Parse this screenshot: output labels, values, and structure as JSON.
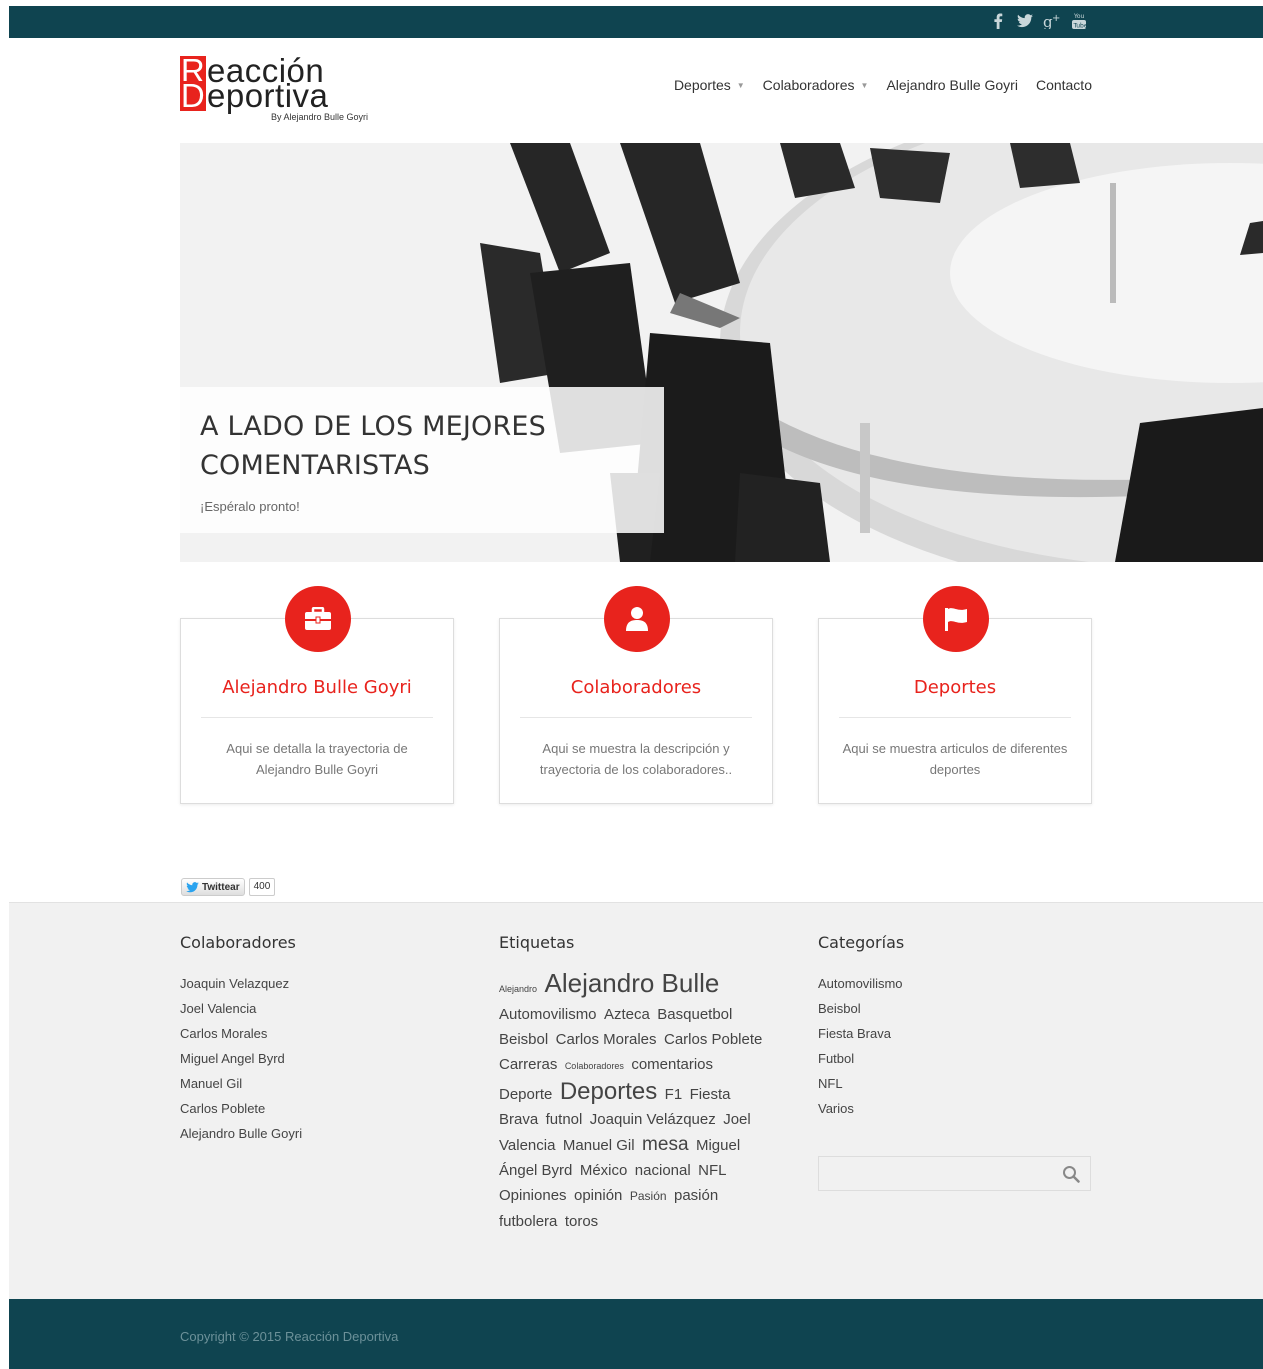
{
  "social": {
    "icons": [
      "facebook-icon",
      "twitter-icon",
      "google-plus-icon",
      "youtube-icon"
    ],
    "labels": [
      "f",
      "",
      "g+",
      ""
    ]
  },
  "header": {
    "logo_line1": "eacción",
    "logo_line1_cap": "R",
    "logo_line2": "eportiva",
    "logo_line2_cap": "D",
    "logo_by": "By Alejandro Bulle Goyri"
  },
  "nav": {
    "items": [
      {
        "label": "Deportes",
        "caret": "▼"
      },
      {
        "label": "Colaboradores",
        "caret": "▼"
      },
      {
        "label": "Alejandro Bulle Goyri"
      },
      {
        "label": "Contacto"
      }
    ]
  },
  "hero": {
    "title": "A LADO DE LOS MEJORES COMENTARISTAS",
    "subtitle": "¡Espéralo pronto!"
  },
  "features": [
    {
      "title": "Alejandro Bulle Goyri",
      "text": "Aqui se detalla la trayectoria de Alejandro Bulle Goyri",
      "icon": "briefcase-icon"
    },
    {
      "title": "Colaboradores",
      "text": "Aqui se muestra la descripción y trayectoria de los colaboradores..",
      "icon": "user-icon"
    },
    {
      "title": "Deportes",
      "text": "Aqui se muestra articulos de diferentes deportes",
      "icon": "flag-icon"
    }
  ],
  "tweet": {
    "label": "Twittear",
    "count": "400"
  },
  "widgets": {
    "colaboradores": {
      "title": "Colaboradores",
      "items": [
        "Joaquin Velazquez",
        "Joel Valencia",
        "Carlos Morales",
        "Miguel Angel Byrd",
        "Manuel Gil",
        "Carlos Poblete",
        "Alejandro Bulle Goyri"
      ]
    },
    "etiquetas": {
      "title": "Etiquetas",
      "tags": [
        {
          "t": "Alejandro",
          "s": 9
        },
        {
          "t": "Alejandro Bulle",
          "s": 26
        },
        {
          "t": "Automovilismo",
          "s": 15
        },
        {
          "t": "Azteca",
          "s": 15
        },
        {
          "t": "Basquetbol",
          "s": 15
        },
        {
          "t": "Beisbol",
          "s": 15
        },
        {
          "t": "Carlos Morales",
          "s": 15
        },
        {
          "t": "Carlos Poblete",
          "s": 15
        },
        {
          "t": "Carreras",
          "s": 15
        },
        {
          "t": "Colaboradores",
          "s": 9
        },
        {
          "t": "comentarios",
          "s": 15
        },
        {
          "t": "Deporte",
          "s": 15
        },
        {
          "t": "Deportes",
          "s": 24
        },
        {
          "t": "F1",
          "s": 15
        },
        {
          "t": "Fiesta Brava",
          "s": 15
        },
        {
          "t": "futnol",
          "s": 15
        },
        {
          "t": "Joaquin Velázquez",
          "s": 15
        },
        {
          "t": "Joel Valencia",
          "s": 15
        },
        {
          "t": "Manuel Gil",
          "s": 15
        },
        {
          "t": "mesa",
          "s": 19
        },
        {
          "t": "Miguel Ángel Byrd",
          "s": 15
        },
        {
          "t": "México",
          "s": 15
        },
        {
          "t": "nacional",
          "s": 15
        },
        {
          "t": "NFL",
          "s": 15
        },
        {
          "t": "Opiniones",
          "s": 15
        },
        {
          "t": "opinión",
          "s": 15
        },
        {
          "t": "Pasión",
          "s": 12
        },
        {
          "t": "pasión futbolera",
          "s": 15
        },
        {
          "t": "toros",
          "s": 15
        }
      ]
    },
    "categorias": {
      "title": "Categorías",
      "items": [
        "Automovilismo",
        "Beisbol",
        "Fiesta Brava",
        "Futbol",
        "NFL",
        "Varios"
      ]
    },
    "search": {
      "placeholder": ""
    }
  },
  "footer": {
    "copyright": "Copyright © 2015 Reacción Deportiva"
  },
  "colors": {
    "accent": "#e8231d",
    "dark": "#0f4450",
    "footer_bg": "#f1f1f1"
  }
}
